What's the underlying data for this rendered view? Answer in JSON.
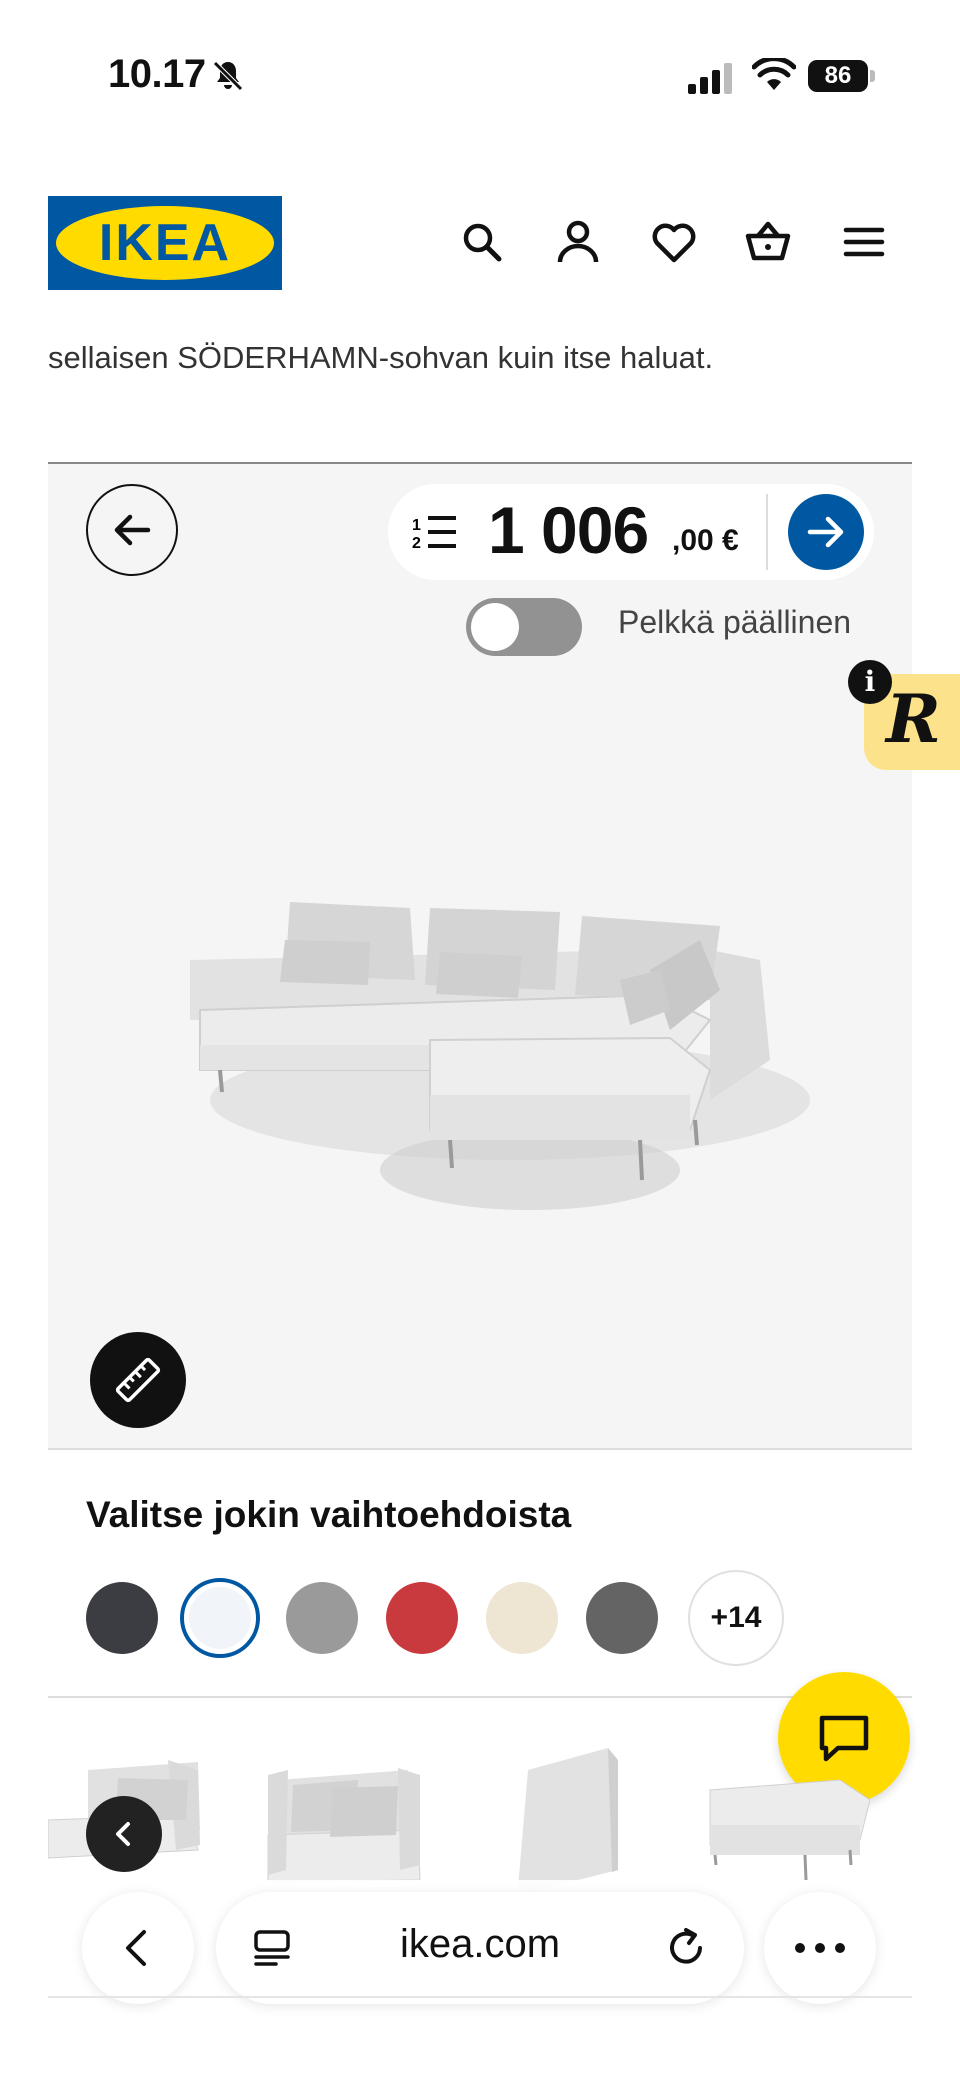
{
  "status_bar": {
    "time": "10.17",
    "battery": "86",
    "icons": [
      "bell-slash-icon",
      "signal-icon",
      "wifi-icon",
      "battery-icon"
    ]
  },
  "header": {
    "logo_text": "IKEA",
    "icons": [
      "search-icon",
      "profile-icon",
      "heart-icon",
      "cart-icon",
      "menu-icon"
    ],
    "brand_blue": "#0058a3",
    "brand_yellow": "#ffdb00"
  },
  "intro": {
    "text": "sellaisen SÖDERHAMN-sohvan kuin itse haluat."
  },
  "configurator": {
    "price_integer": "1 006",
    "price_decimal": ",00 €",
    "toggle_label": "Pelkkä päällinen",
    "toggle_on": false,
    "badge_letter": "R",
    "info_label": "i"
  },
  "options": {
    "title": "Valitse jokin vaihtoehdoista",
    "swatches": [
      {
        "color": "#3c3d42",
        "selected": false
      },
      {
        "color": "#f1f4f9",
        "selected": true
      },
      {
        "color": "#9a9a9a",
        "selected": false
      },
      {
        "color": "#c93a3e",
        "selected": false
      },
      {
        "color": "#efe5d3",
        "selected": false
      },
      {
        "color": "#646464",
        "selected": false
      }
    ],
    "more_label": "+14"
  },
  "browser": {
    "url": "ikea.com"
  }
}
